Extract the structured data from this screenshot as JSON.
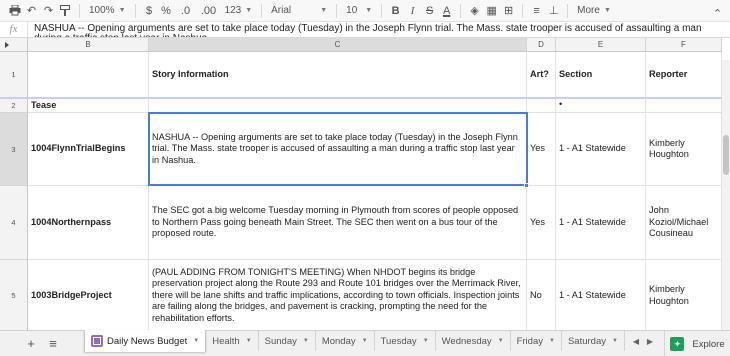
{
  "toolbar": {
    "zoom": "100%",
    "currency": "$",
    "percent": "%",
    "dec_decrease": ".0",
    "dec_increase": ".00",
    "more_formats": "123",
    "font": "Arial",
    "font_size": "10",
    "bold": "B",
    "italic": "I",
    "strike": "S",
    "text_color": "A",
    "more": "More"
  },
  "formula_bar": {
    "fx": "fx",
    "value": "NASHUA -- Opening arguments are set to take place today (Tuesday) in the Joseph Flynn trial. The Mass. state trooper is accused of assaulting a man during a traffic stop last year in Nashua."
  },
  "columns": [
    "B",
    "C",
    "D",
    "E",
    "F"
  ],
  "rows": [
    {
      "num": "1",
      "b": "",
      "c": "Story Information",
      "d": "Art?",
      "e": "Section",
      "f": "Reporter"
    },
    {
      "num": "2",
      "b": "Tease",
      "c": "",
      "d": "",
      "e": "•",
      "f": ""
    },
    {
      "num": "3",
      "b": "1004FlynnTrialBegins",
      "c": "NASHUA -- Opening arguments are set to take place today (Tuesday) in the Joseph Flynn trial. The Mass. state trooper is accused of assaulting a man during a traffic stop last year in Nashua.",
      "d": "Yes",
      "e": "1 - A1 Statewide",
      "f": "Kimberly Houghton"
    },
    {
      "num": "4",
      "b": "1004Northernpass",
      "c": "The SEC got a big welcome Tuesday morning in Plymouth from scores of people opposed to Northern Pass going beneath Main Street. The SEC then went on a bus tour of the proposed route.",
      "d": "Yes",
      "e": "1 - A1 Statewide",
      "f": "John Koziol/Michael Cousineau"
    },
    {
      "num": "5",
      "b": "1003BridgeProject",
      "c": "(PAUL ADDING FROM TONIGHT'S MEETING) When NHDOT begins its bridge preservation project along the Route 293 and Route 101 bridges over the Merrimack River, there will be lane shifts and traffic implications, according to town officials. Inspection joints are failing along the bridges, and pavement is cracking, prompting the need for the rehabilitation efforts.",
      "d": "No",
      "e": "1 - A1 Statewide",
      "f": "Kimberly Houghton"
    }
  ],
  "sheet_tabs": [
    "Daily News Budget",
    "Health",
    "Sunday",
    "Monday",
    "Tuesday",
    "Wednesday",
    "Friday",
    "Saturday"
  ],
  "explore_label": "Explore",
  "colors": {
    "selection": "#4a7bdb",
    "explore": "#1e9e5a",
    "tab_badge": "#8e6bc7"
  }
}
